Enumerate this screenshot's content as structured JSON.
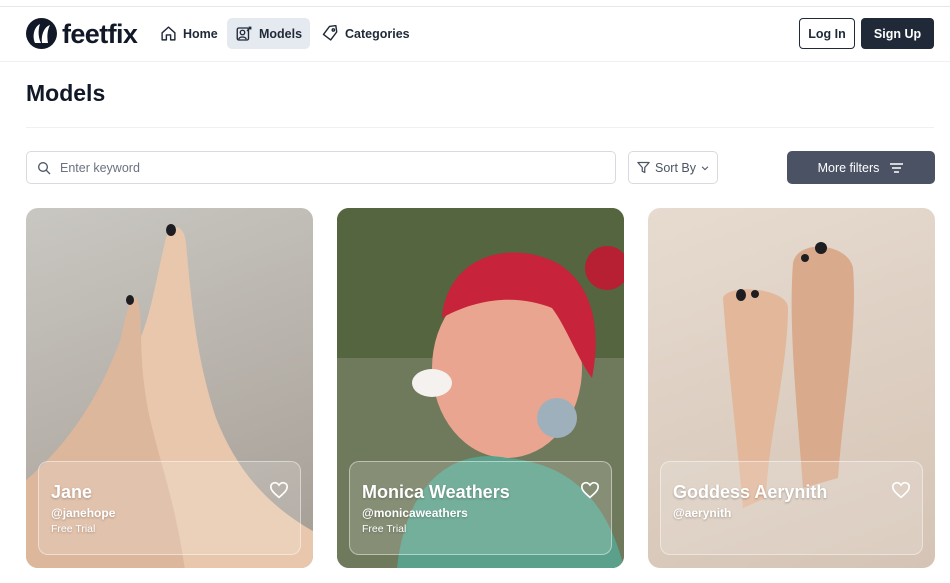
{
  "brand": {
    "name": "feetfix"
  },
  "nav": {
    "home": "Home",
    "models": "Models",
    "categories": "Categories"
  },
  "auth": {
    "login": "Log In",
    "signup": "Sign Up"
  },
  "page": {
    "title": "Models"
  },
  "filters": {
    "search_placeholder": "Enter keyword",
    "search_value": "",
    "sort_label": "Sort By",
    "more_filters": "More filters"
  },
  "models": [
    {
      "name": "Jane",
      "handle": "@janehope",
      "plan": "Free Trial"
    },
    {
      "name": "Monica Weathers",
      "handle": "@monicaweathers",
      "plan": "Free Trial"
    },
    {
      "name": "Goddess Aerynith",
      "handle": "@aerynith",
      "plan": ""
    }
  ],
  "colors": {
    "primary_dark": "#1f2937",
    "filter_button": "#4a5263",
    "active_nav_bg": "#e5e9f0"
  },
  "icons": {
    "home": "home-icon",
    "models": "models-icon",
    "categories": "tag-icon",
    "search": "search-icon",
    "sort": "filter-funnel-icon",
    "chevron": "chevron-down-icon",
    "more_filters": "sliders-lines-icon",
    "favorite": "heart-icon"
  }
}
